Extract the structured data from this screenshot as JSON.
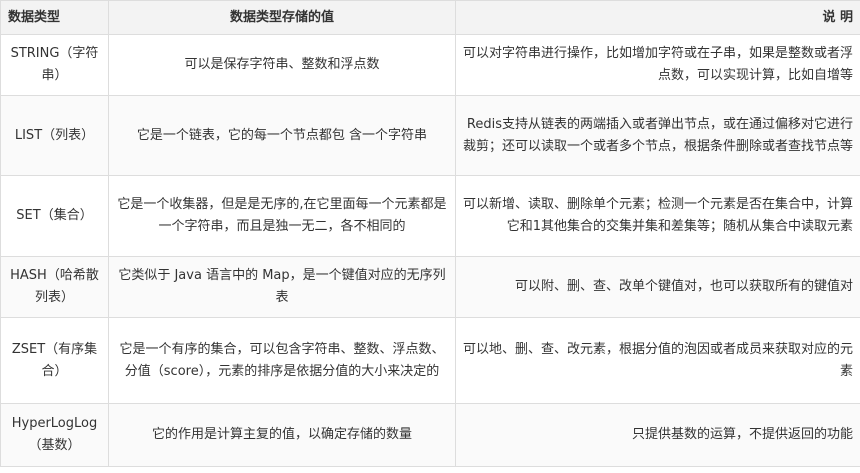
{
  "table": {
    "headers": {
      "type": "数据类型",
      "value": "数据类型存储的值",
      "desc": "说 明"
    },
    "rows": [
      {
        "type": "STRING（字符串）",
        "value": "可以是保存字符串、整数和浮点数",
        "desc": "可以对字符串进行操作，比如增加字符或在子串，如果是整数或者浮点数，可以实现计算，比如自增等"
      },
      {
        "type": "LIST（列表）",
        "value": "它是一个链表，它的每一个节点都包 含一个字符串",
        "desc": "Redis支持从链表的两端插入或者弹出节点，或在通过偏移对它进行裁剪；还可以读取一个或者多个节点，根据条件删除或者查找节点等"
      },
      {
        "type": "SET（集合）",
        "value": "它是一个收集器，但是是无序的,在它里面每一个元素都是一个字符串，而且是独一无二，各不相同的",
        "desc": "可以新增、读取、删除单个元素；检测一个元素是否在集合中，计算它和1其他集合的交集并集和差集等；随机从集合中读取元素"
      },
      {
        "type": "HASH（哈希散列表）",
        "value": "它类似于 Java 语言中的 Map，是一个键值对应的无序列表",
        "desc": "可以附、删、查、改单个键值对，也可以获取所有的键值对"
      },
      {
        "type": "ZSET（有序集合）",
        "value": "它是一个有序的集合，可以包含字符串、整数、浮点数、分值（score），元素的排序是依据分值的大小来决定的",
        "desc": "可以地、删、查、改元素，根据分值的泡因或者成员来获取对应的元素"
      },
      {
        "type": "HyperLogLog（基数）",
        "value": "它的作用是计算主复的值，以确定存储的数量",
        "desc": "只提供基数的运算，不提供返回的功能"
      }
    ]
  }
}
